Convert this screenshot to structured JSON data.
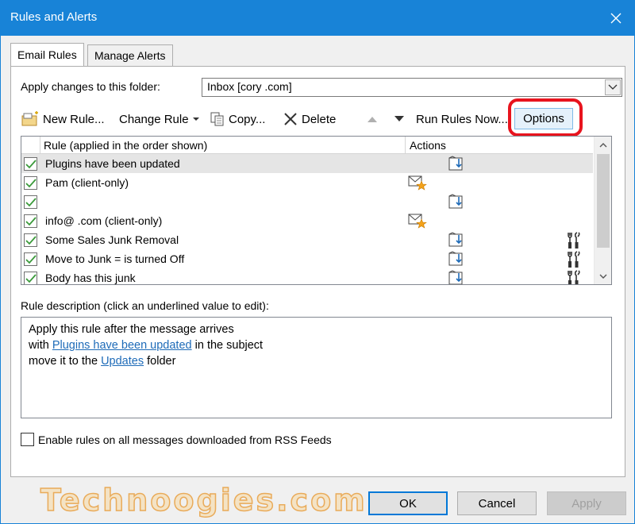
{
  "window": {
    "title": "Rules and Alerts"
  },
  "tabs": [
    {
      "label": "Email Rules",
      "active": true
    },
    {
      "label": "Manage Alerts",
      "active": false
    }
  ],
  "folder": {
    "label": "Apply changes to this folder:",
    "value": "Inbox [cory                  .com]"
  },
  "toolbar": {
    "new_rule": "New Rule...",
    "change_rule": "Change Rule",
    "copy": "Copy...",
    "delete": "Delete",
    "run_rules": "Run Rules Now...",
    "options": "Options"
  },
  "grid": {
    "columns": [
      "Rule (applied in the order shown)",
      "Actions"
    ],
    "rows": [
      {
        "name": "Plugins have been updated",
        "checked": true,
        "selected": true,
        "action_icon": "move-to-folder-icon",
        "rule_icon": ""
      },
      {
        "name": "Pam                   (client-only)",
        "checked": true,
        "selected": false,
        "action_icon": "mail-star-icon",
        "rule_icon": ""
      },
      {
        "name": "",
        "checked": true,
        "selected": false,
        "action_icon": "move-to-folder-icon",
        "rule_icon": ""
      },
      {
        "name": "info@                          .com  (client-only)",
        "checked": true,
        "selected": false,
        "action_icon": "mail-star-icon",
        "rule_icon": ""
      },
      {
        "name": "Some Sales Junk Removal",
        "checked": true,
        "selected": false,
        "action_icon": "move-to-folder-icon",
        "rule_icon": "tools-icon"
      },
      {
        "name": "Move to Junk =                               is turned Off",
        "checked": true,
        "selected": false,
        "action_icon": "move-to-folder-icon",
        "rule_icon": "tools-icon"
      },
      {
        "name": "Body has this junk",
        "checked": true,
        "selected": false,
        "action_icon": "move-to-folder-icon",
        "rule_icon": "tools-icon"
      }
    ]
  },
  "description": {
    "label": "Rule description (click an underlined value to edit):",
    "line1": "Apply this rule after the message arrives",
    "line2_prefix": "with",
    "line2_link": "Plugins have been updated",
    "line2_suffix": "in the subject",
    "line3_prefix": "move it to the",
    "line3_link": "Updates",
    "line3_suffix": "folder"
  },
  "rss": {
    "label": "Enable rules on all messages downloaded from RSS Feeds",
    "checked": false
  },
  "buttons": {
    "ok": "OK",
    "cancel": "Cancel",
    "apply": "Apply"
  },
  "watermark": "Technoogies.com",
  "colors": {
    "titlebar": "#1883d7",
    "highlight": "#e8141e",
    "link": "#1e6bb8",
    "check": "#3a9a3a"
  }
}
